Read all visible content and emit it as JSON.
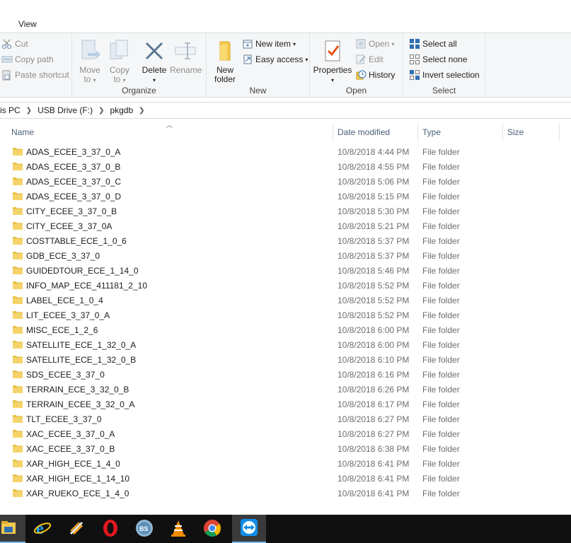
{
  "ribbon": {
    "tab_view": "View",
    "clipboard": {
      "cut": "Cut",
      "copy_path": "Copy path",
      "paste_shortcut": "Paste shortcut"
    },
    "organize": {
      "label": "Organize",
      "move_to": "Move",
      "move_to_sub": "to",
      "copy_to": "Copy",
      "copy_to_sub": "to",
      "delete": "Delete",
      "rename": "Rename"
    },
    "new": {
      "label": "New",
      "new_folder_line1": "New",
      "new_folder_line2": "folder",
      "new_item": "New item",
      "easy_access": "Easy access"
    },
    "open": {
      "label": "Open",
      "properties": "Properties",
      "open": "Open",
      "edit": "Edit",
      "history": "History"
    },
    "select": {
      "label": "Select",
      "select_all": "Select all",
      "select_none": "Select none",
      "invert_selection": "Invert selection"
    }
  },
  "address": {
    "crumbs": [
      "is PC",
      "USB Drive (F:)",
      "pkgdb"
    ]
  },
  "columns": {
    "name": "Name",
    "date_modified": "Date modified",
    "type": "Type",
    "size": "Size"
  },
  "files": [
    {
      "name": "ADAS_ECEE_3_37_0_A",
      "date": "10/8/2018 4:44 PM",
      "type": "File folder"
    },
    {
      "name": "ADAS_ECEE_3_37_0_B",
      "date": "10/8/2018 4:55 PM",
      "type": "File folder"
    },
    {
      "name": "ADAS_ECEE_3_37_0_C",
      "date": "10/8/2018 5:06 PM",
      "type": "File folder"
    },
    {
      "name": "ADAS_ECEE_3_37_0_D",
      "date": "10/8/2018 5:15 PM",
      "type": "File folder"
    },
    {
      "name": "CITY_ECEE_3_37_0_B",
      "date": "10/8/2018 5:30 PM",
      "type": "File folder"
    },
    {
      "name": "CITY_ECEE_3_37_0A",
      "date": "10/8/2018 5:21 PM",
      "type": "File folder"
    },
    {
      "name": "COSTTABLE_ECE_1_0_6",
      "date": "10/8/2018 5:37 PM",
      "type": "File folder"
    },
    {
      "name": "GDB_ECE_3_37_0",
      "date": "10/8/2018 5:37 PM",
      "type": "File folder"
    },
    {
      "name": "GUIDEDTOUR_ECE_1_14_0",
      "date": "10/8/2018 5:46 PM",
      "type": "File folder"
    },
    {
      "name": "INFO_MAP_ECE_411181_2_10",
      "date": "10/8/2018 5:52 PM",
      "type": "File folder"
    },
    {
      "name": "LABEL_ECE_1_0_4",
      "date": "10/8/2018 5:52 PM",
      "type": "File folder"
    },
    {
      "name": "LIT_ECEE_3_37_0_A",
      "date": "10/8/2018 5:52 PM",
      "type": "File folder"
    },
    {
      "name": "MISC_ECE_1_2_6",
      "date": "10/8/2018 6:00 PM",
      "type": "File folder"
    },
    {
      "name": "SATELLITE_ECE_1_32_0_A",
      "date": "10/8/2018 6:00 PM",
      "type": "File folder"
    },
    {
      "name": "SATELLITE_ECE_1_32_0_B",
      "date": "10/8/2018 6:10 PM",
      "type": "File folder"
    },
    {
      "name": "SDS_ECEE_3_37_0",
      "date": "10/8/2018 6:16 PM",
      "type": "File folder"
    },
    {
      "name": "TERRAIN_ECE_3_32_0_B",
      "date": "10/8/2018 6:26 PM",
      "type": "File folder"
    },
    {
      "name": "TERRAIN_ECEE_3_32_0_A",
      "date": "10/8/2018 6:17 PM",
      "type": "File folder"
    },
    {
      "name": "TLT_ECEE_3_37_0",
      "date": "10/8/2018 6:27 PM",
      "type": "File folder"
    },
    {
      "name": "XAC_ECEE_3_37_0_A",
      "date": "10/8/2018 6:27 PM",
      "type": "File folder"
    },
    {
      "name": "XAC_ECEE_3_37_0_B",
      "date": "10/8/2018 6:38 PM",
      "type": "File folder"
    },
    {
      "name": "XAR_HIGH_ECE_1_4_0",
      "date": "10/8/2018 6:41 PM",
      "type": "File folder"
    },
    {
      "name": "XAR_HIGH_ECE_1_14_10",
      "date": "10/8/2018 6:41 PM",
      "type": "File folder"
    },
    {
      "name": "XAR_RUEKO_ECE_1_4_0",
      "date": "10/8/2018 6:41 PM",
      "type": "File folder"
    }
  ],
  "taskbar": {
    "items": [
      "file-explorer-icon",
      "internet-explorer-icon",
      "app-icon",
      "opera-icon",
      "bluestacks-icon",
      "vlc-icon",
      "chrome-icon",
      "teamviewer-icon"
    ]
  },
  "colors": {
    "accent": "#0078d7",
    "folder": "#e8c24b",
    "taskbar": "#101010"
  }
}
